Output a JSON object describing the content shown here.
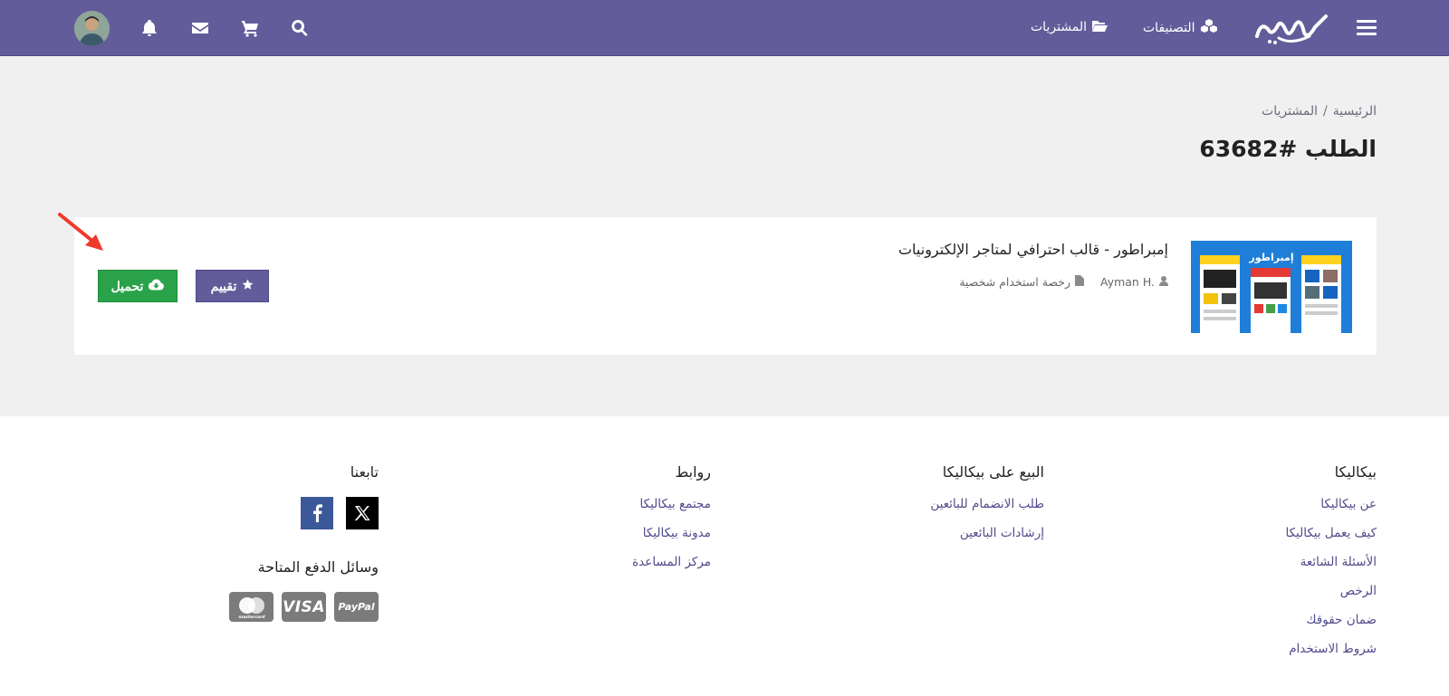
{
  "header": {
    "nav_categories": "التصنيفات",
    "nav_purchases": "المشتريات",
    "icons": [
      "menu-icon",
      "cubes-icon",
      "folder-open-icon",
      "search-icon",
      "cart-icon",
      "envelope-icon",
      "bell-icon"
    ],
    "brand_color": "#635c9b"
  },
  "breadcrumb": {
    "home": "الرئيسية",
    "separator": "/",
    "current": "المشتريات"
  },
  "page": {
    "title": "الطلب #63682"
  },
  "order": {
    "product_title": "إمبراطور - قالب احترافي لمتاجر الإلكترونيات",
    "thumbnail_caption": "إمبراطور",
    "author": "Ayman H.",
    "license": "رخصة استخدام شخصية",
    "rate_label": "تقييم",
    "download_label": "تحميل",
    "download_color": "#2aa24a"
  },
  "footer": {
    "col_brand": {
      "title": "بيكاليكا",
      "links": [
        "عن بيكاليكا",
        "كيف يعمل بيكاليكا",
        "الأسئلة الشائعة",
        "الرخص",
        "ضمان حقوقك",
        "شروط الاستخدام"
      ]
    },
    "col_sell": {
      "title": "البيع على بيكاليكا",
      "links": [
        "طلب الانضمام للبائعين",
        "إرشادات البائعين"
      ]
    },
    "col_links": {
      "title": "روابط",
      "links": [
        "مجتمع بيكاليكا",
        "مدونة بيكاليكا",
        "مركز المساعدة"
      ]
    },
    "col_follow": {
      "title": "تابعنا",
      "payments_title": "وسائل الدفع المتاحة",
      "payments": [
        "PayPal",
        "VISA",
        "mastercard"
      ]
    }
  }
}
